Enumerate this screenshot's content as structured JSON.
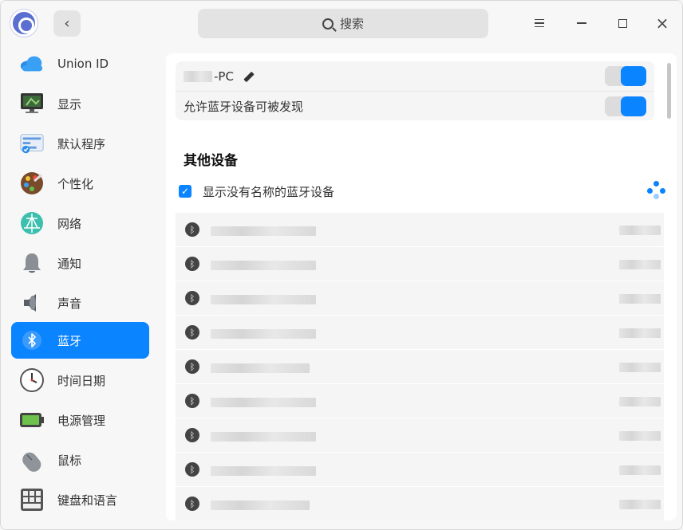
{
  "titlebar": {
    "search_placeholder": "搜索",
    "icons": {
      "logo": "control-center-logo",
      "back": "chevron-left-icon",
      "search": "search-icon",
      "menu": "menu-icon",
      "minimize": "minimize-icon",
      "maximize": "maximize-icon",
      "close": "close-icon"
    },
    "back_glyph": "‹",
    "close_glyph": "×"
  },
  "sidebar": {
    "items": [
      {
        "label": "Union ID",
        "icon": "cloud-icon",
        "active": false
      },
      {
        "label": "显示",
        "icon": "monitor-icon",
        "active": false
      },
      {
        "label": "默认程序",
        "icon": "default-apps-icon",
        "active": false
      },
      {
        "label": "个性化",
        "icon": "palette-icon",
        "active": false
      },
      {
        "label": "网络",
        "icon": "network-icon",
        "active": false
      },
      {
        "label": "通知",
        "icon": "bell-icon",
        "active": false
      },
      {
        "label": "声音",
        "icon": "speaker-icon",
        "active": false
      },
      {
        "label": "蓝牙",
        "icon": "bluetooth-icon",
        "active": true
      },
      {
        "label": "时间日期",
        "icon": "clock-icon",
        "active": false
      },
      {
        "label": "电源管理",
        "icon": "battery-icon",
        "active": false
      },
      {
        "label": "鼠标",
        "icon": "mouse-icon",
        "active": false
      },
      {
        "label": "键盘和语言",
        "icon": "keyboard-icon",
        "active": false
      }
    ]
  },
  "bluetooth": {
    "device_name_suffix": "-PC",
    "device_toggle_on": true,
    "discoverable_label": "允许蓝牙设备可被发现",
    "discoverable_on": true,
    "other_devices_title": "其他设备",
    "show_unnamed_label": "显示没有名称的蓝牙设备",
    "show_unnamed_checked": true,
    "checkmark": "✓",
    "bt_glyph": "ᛒ"
  },
  "colors": {
    "accent": "#0a84ff",
    "window_bg": "#f7f7f7",
    "card_bg": "#f5f5f5"
  }
}
